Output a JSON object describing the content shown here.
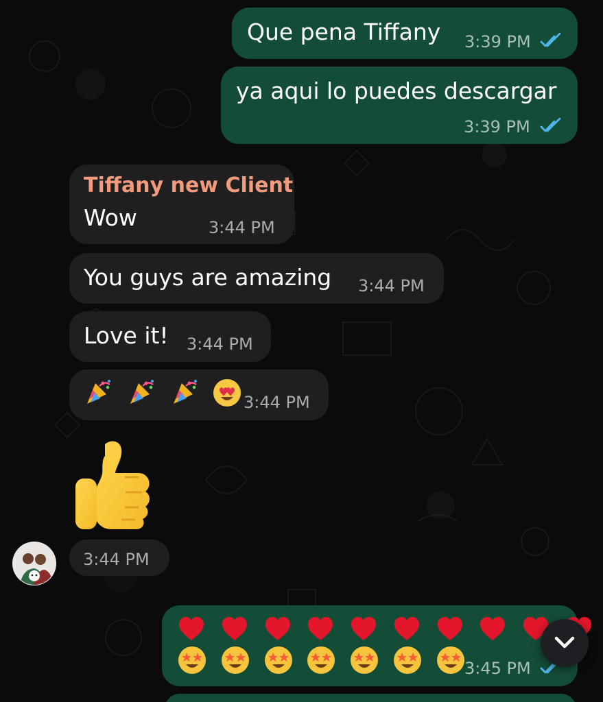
{
  "theme": {
    "background": "#0b0b0b",
    "outgoing_bubble": "#144d37",
    "incoming_bubble": "#1f1f1f",
    "sender_color": "#f19a7d",
    "tick_color": "#4fb6ec"
  },
  "messages": [
    {
      "text": "Que pena Tiffany",
      "time": "3:39 PM"
    },
    {
      "text": "ya aqui lo puedes descargar",
      "time": "3:39 PM"
    },
    {
      "sender": "Tiffany new Client",
      "text": "Wow",
      "time": "3:44 PM"
    },
    {
      "text": "You guys are amazing",
      "time": "3:44 PM"
    },
    {
      "text": "Love it!",
      "time": "3:44 PM"
    },
    {
      "emoji": "🎉🎉🎉😍",
      "time": "3:44 PM"
    },
    {
      "emoji": "👍",
      "time": "3:44 PM"
    },
    {
      "emoji": "❤️❤️❤️❤️❤️❤️❤️❤️❤️❤️🤩🤩🤩🤩🤩🤩🤩🤩",
      "time": "3:45 PM"
    }
  ],
  "icons": {
    "read_receipt": "double-check-icon",
    "scroll_down": "chevron-down-icon",
    "avatar": "contact-avatar"
  }
}
